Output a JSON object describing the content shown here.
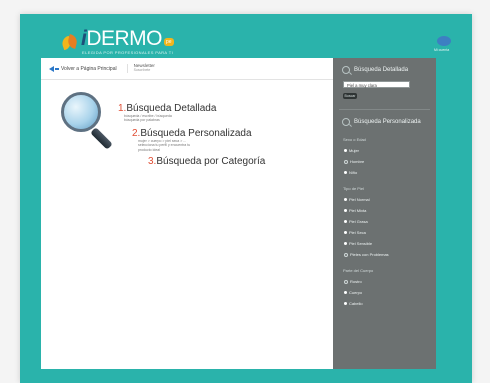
{
  "header": {
    "logo_prefix": "i",
    "logo_main": "DERMO",
    "logo_badge": "pe",
    "logo_sub": "ELEGIDA POR PROFESIONALES PARA TI",
    "account_label": "Mi cuenta",
    "colors": {
      "background": "#2ab3ab",
      "logo_blue": "#1c4f7a",
      "accent_orange": "#e67e22"
    }
  },
  "nav": {
    "back_label": "Volver a Página Principal",
    "newsletter_label": "Newsletter",
    "newsletter_sub": "Suscríbete"
  },
  "search_options": [
    {
      "number": "1.",
      "title": "Búsqueda Detallada",
      "desc": [
        "búsqueda / escribe / búsqueda",
        "búsqueda por palabras"
      ]
    },
    {
      "number": "2.",
      "title": "Búsqueda Personalizada",
      "desc": [
        "mujer > cuerpo > piel seca > ...",
        "selecciona tu perfil y encuentra tu",
        "producto ideal"
      ]
    },
    {
      "number": "3.",
      "title": "Búsqueda por Categoría",
      "desc": []
    }
  ],
  "sidebar": {
    "detailed_heading": "Búsqueda Detallada",
    "search_value": "Piel a muy clara",
    "search_button": "Buscar",
    "personal_heading": "Búsqueda Personalizada",
    "sections": [
      {
        "title": "Sexo o Edad",
        "options": [
          {
            "label": "Mujer",
            "selected": true
          },
          {
            "label": "Hombre",
            "selected": false
          },
          {
            "label": "Niño",
            "selected": true
          }
        ]
      },
      {
        "title": "Tipo de Piel",
        "options": [
          {
            "label": "Piel Normal",
            "selected": true
          },
          {
            "label": "Piel Mixta",
            "selected": true
          },
          {
            "label": "Piel Grasa",
            "selected": true
          },
          {
            "label": "Piel Seca",
            "selected": true
          },
          {
            "label": "Piel Sensible",
            "selected": true
          },
          {
            "label": "Pieles con Problemas",
            "selected": false
          }
        ]
      },
      {
        "title": "Parte del Cuerpo",
        "options": [
          {
            "label": "Rostro",
            "selected": false
          },
          {
            "label": "Cuerpo",
            "selected": true
          },
          {
            "label": "Cabello",
            "selected": true
          }
        ]
      }
    ]
  }
}
